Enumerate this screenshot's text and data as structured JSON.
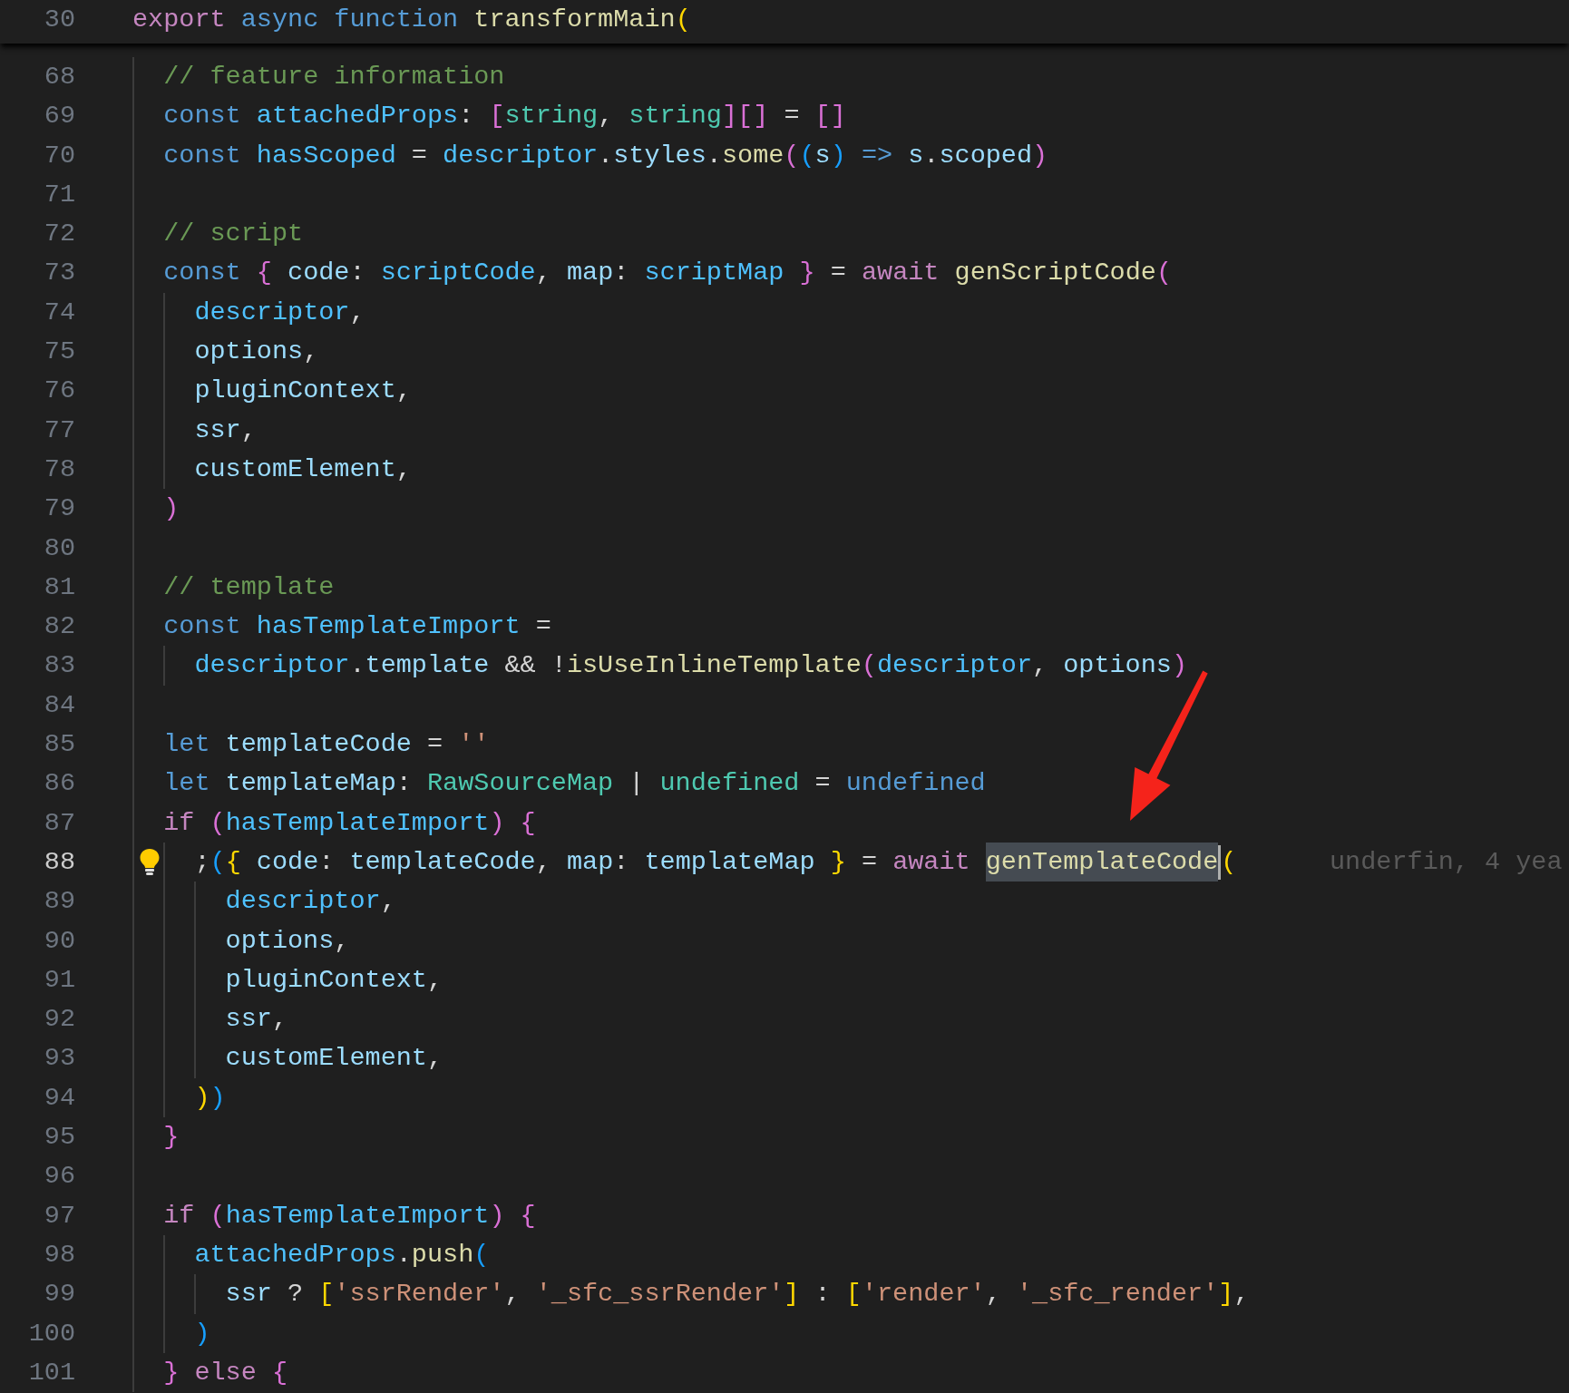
{
  "sticky_line": {
    "number": "30",
    "tokens": [
      {
        "kind": "control",
        "text": "export"
      },
      {
        "kind": "keyword",
        "text": " async"
      },
      {
        "kind": "keyword",
        "text": " function"
      },
      {
        "kind": "function",
        "text": " transformMain"
      },
      {
        "kind": "bracket1",
        "text": "("
      }
    ]
  },
  "lines": [
    {
      "number": "68",
      "current": false,
      "tokens": [
        {
          "kind": "comment",
          "text": "  // feature information"
        }
      ]
    },
    {
      "number": "69",
      "current": false,
      "tokens": [
        {
          "kind": "keyword",
          "text": "  const"
        },
        {
          "kind": "constant",
          "text": " attachedProps"
        },
        {
          "kind": "punct",
          "text": ": "
        },
        {
          "kind": "bracket2",
          "text": "["
        },
        {
          "kind": "type",
          "text": "string"
        },
        {
          "kind": "punct",
          "text": ", "
        },
        {
          "kind": "type",
          "text": "string"
        },
        {
          "kind": "bracket2",
          "text": "][]"
        },
        {
          "kind": "punct",
          "text": " = "
        },
        {
          "kind": "bracket2",
          "text": "[]"
        }
      ]
    },
    {
      "number": "70",
      "current": false,
      "tokens": [
        {
          "kind": "keyword",
          "text": "  const"
        },
        {
          "kind": "constant",
          "text": " hasScoped"
        },
        {
          "kind": "punct",
          "text": " = "
        },
        {
          "kind": "constant",
          "text": "descriptor"
        },
        {
          "kind": "punct",
          "text": "."
        },
        {
          "kind": "variable",
          "text": "styles"
        },
        {
          "kind": "punct",
          "text": "."
        },
        {
          "kind": "function",
          "text": "some"
        },
        {
          "kind": "bracket2",
          "text": "("
        },
        {
          "kind": "bracket3",
          "text": "("
        },
        {
          "kind": "variable",
          "text": "s"
        },
        {
          "kind": "bracket3",
          "text": ")"
        },
        {
          "kind": "keyword",
          "text": " =>"
        },
        {
          "kind": "variable",
          "text": " s"
        },
        {
          "kind": "punct",
          "text": "."
        },
        {
          "kind": "variable",
          "text": "scoped"
        },
        {
          "kind": "bracket2",
          "text": ")"
        }
      ]
    },
    {
      "number": "71",
      "current": false
    },
    {
      "number": "72",
      "current": false,
      "tokens": [
        {
          "kind": "comment",
          "text": "  // script"
        }
      ]
    },
    {
      "number": "73",
      "current": false,
      "tokens": [
        {
          "kind": "keyword",
          "text": "  const"
        },
        {
          "kind": "bracket2",
          "text": " {"
        },
        {
          "kind": "variable",
          "text": " code"
        },
        {
          "kind": "punct",
          "text": ": "
        },
        {
          "kind": "constant",
          "text": "scriptCode"
        },
        {
          "kind": "punct",
          "text": ", "
        },
        {
          "kind": "variable",
          "text": "map"
        },
        {
          "kind": "punct",
          "text": ": "
        },
        {
          "kind": "constant",
          "text": "scriptMap"
        },
        {
          "kind": "bracket2",
          "text": " }"
        },
        {
          "kind": "punct",
          "text": " = "
        },
        {
          "kind": "control",
          "text": "await"
        },
        {
          "kind": "function",
          "text": " genScriptCode"
        },
        {
          "kind": "bracket2",
          "text": "("
        }
      ]
    },
    {
      "number": "74",
      "current": false,
      "tokens": [
        {
          "kind": "constant",
          "text": "    descriptor"
        },
        {
          "kind": "punct",
          "text": ","
        }
      ]
    },
    {
      "number": "75",
      "current": false,
      "tokens": [
        {
          "kind": "variable",
          "text": "    options"
        },
        {
          "kind": "punct",
          "text": ","
        }
      ]
    },
    {
      "number": "76",
      "current": false,
      "tokens": [
        {
          "kind": "variable",
          "text": "    pluginContext"
        },
        {
          "kind": "punct",
          "text": ","
        }
      ]
    },
    {
      "number": "77",
      "current": false,
      "tokens": [
        {
          "kind": "variable",
          "text": "    ssr"
        },
        {
          "kind": "punct",
          "text": ","
        }
      ]
    },
    {
      "number": "78",
      "current": false,
      "tokens": [
        {
          "kind": "variable",
          "text": "    customElement"
        },
        {
          "kind": "punct",
          "text": ","
        }
      ]
    },
    {
      "number": "79",
      "current": false,
      "tokens": [
        {
          "kind": "bracket2",
          "text": "  )"
        }
      ]
    },
    {
      "number": "80",
      "current": false
    },
    {
      "number": "81",
      "current": false,
      "tokens": [
        {
          "kind": "comment",
          "text": "  // template"
        }
      ]
    },
    {
      "number": "82",
      "current": false,
      "tokens": [
        {
          "kind": "keyword",
          "text": "  const"
        },
        {
          "kind": "constant",
          "text": " hasTemplateImport"
        },
        {
          "kind": "punct",
          "text": " ="
        }
      ]
    },
    {
      "number": "83",
      "current": false,
      "tokens": [
        {
          "kind": "constant",
          "text": "    descriptor"
        },
        {
          "kind": "punct",
          "text": "."
        },
        {
          "kind": "variable",
          "text": "template"
        },
        {
          "kind": "punct",
          "text": " && !"
        },
        {
          "kind": "function",
          "text": "isUseInlineTemplate"
        },
        {
          "kind": "bracket2",
          "text": "("
        },
        {
          "kind": "constant",
          "text": "descriptor"
        },
        {
          "kind": "punct",
          "text": ", "
        },
        {
          "kind": "variable",
          "text": "options"
        },
        {
          "kind": "bracket2",
          "text": ")"
        }
      ]
    },
    {
      "number": "84",
      "current": false
    },
    {
      "number": "85",
      "current": false,
      "tokens": [
        {
          "kind": "keyword",
          "text": "  let"
        },
        {
          "kind": "variable",
          "text": " templateCode"
        },
        {
          "kind": "punct",
          "text": " = "
        },
        {
          "kind": "string",
          "text": "''"
        }
      ]
    },
    {
      "number": "86",
      "current": false,
      "tokens": [
        {
          "kind": "keyword",
          "text": "  let"
        },
        {
          "kind": "variable",
          "text": " templateMap"
        },
        {
          "kind": "punct",
          "text": ": "
        },
        {
          "kind": "type",
          "text": "RawSourceMap"
        },
        {
          "kind": "punct",
          "text": " | "
        },
        {
          "kind": "type",
          "text": "undefined"
        },
        {
          "kind": "punct",
          "text": " = "
        },
        {
          "kind": "keyword",
          "text": "undefined"
        }
      ]
    },
    {
      "number": "87",
      "current": false,
      "tokens": [
        {
          "kind": "control",
          "text": "  if"
        },
        {
          "kind": "bracket2",
          "text": " ("
        },
        {
          "kind": "constant",
          "text": "hasTemplateImport"
        },
        {
          "kind": "bracket2",
          "text": ")"
        },
        {
          "kind": "bracket2",
          "text": " {"
        }
      ]
    },
    {
      "number": "88",
      "current": true,
      "lightbulb": true,
      "blame": "underfin, 4 yea",
      "tokens": [
        {
          "kind": "punct",
          "text": "    ;"
        },
        {
          "kind": "bracket3",
          "text": "("
        },
        {
          "kind": "bracket1",
          "text": "{"
        },
        {
          "kind": "variable",
          "text": " code"
        },
        {
          "kind": "punct",
          "text": ": "
        },
        {
          "kind": "variable",
          "text": "templateCode"
        },
        {
          "kind": "punct",
          "text": ", "
        },
        {
          "kind": "variable",
          "text": "map"
        },
        {
          "kind": "punct",
          "text": ": "
        },
        {
          "kind": "variable",
          "text": "templateMap"
        },
        {
          "kind": "bracket1",
          "text": " }"
        },
        {
          "kind": "punct",
          "text": " = "
        },
        {
          "kind": "control",
          "text": "await "
        },
        {
          "kind": "function",
          "text": "genTemplateCode",
          "highlighted": true
        },
        {
          "kind": "bracket1",
          "text": "("
        }
      ]
    },
    {
      "number": "89",
      "current": false,
      "tokens": [
        {
          "kind": "constant",
          "text": "      descriptor"
        },
        {
          "kind": "punct",
          "text": ","
        }
      ]
    },
    {
      "number": "90",
      "current": false,
      "tokens": [
        {
          "kind": "variable",
          "text": "      options"
        },
        {
          "kind": "punct",
          "text": ","
        }
      ]
    },
    {
      "number": "91",
      "current": false,
      "tokens": [
        {
          "kind": "variable",
          "text": "      pluginContext"
        },
        {
          "kind": "punct",
          "text": ","
        }
      ]
    },
    {
      "number": "92",
      "current": false,
      "tokens": [
        {
          "kind": "variable",
          "text": "      ssr"
        },
        {
          "kind": "punct",
          "text": ","
        }
      ]
    },
    {
      "number": "93",
      "current": false,
      "tokens": [
        {
          "kind": "variable",
          "text": "      customElement"
        },
        {
          "kind": "punct",
          "text": ","
        }
      ]
    },
    {
      "number": "94",
      "current": false,
      "tokens": [
        {
          "kind": "bracket1",
          "text": "    )"
        },
        {
          "kind": "bracket3",
          "text": ")"
        }
      ]
    },
    {
      "number": "95",
      "current": false,
      "tokens": [
        {
          "kind": "bracket2",
          "text": "  }"
        }
      ]
    },
    {
      "number": "96",
      "current": false
    },
    {
      "number": "97",
      "current": false,
      "tokens": [
        {
          "kind": "control",
          "text": "  if"
        },
        {
          "kind": "bracket2",
          "text": " ("
        },
        {
          "kind": "constant",
          "text": "hasTemplateImport"
        },
        {
          "kind": "bracket2",
          "text": ")"
        },
        {
          "kind": "bracket2",
          "text": " {"
        }
      ]
    },
    {
      "number": "98",
      "current": false,
      "tokens": [
        {
          "kind": "constant",
          "text": "    attachedProps"
        },
        {
          "kind": "punct",
          "text": "."
        },
        {
          "kind": "function",
          "text": "push"
        },
        {
          "kind": "bracket3",
          "text": "("
        }
      ]
    },
    {
      "number": "99",
      "current": false,
      "tokens": [
        {
          "kind": "variable",
          "text": "      ssr"
        },
        {
          "kind": "punct",
          "text": " ? "
        },
        {
          "kind": "bracket1",
          "text": "["
        },
        {
          "kind": "string",
          "text": "'ssrRender'"
        },
        {
          "kind": "punct",
          "text": ", "
        },
        {
          "kind": "string",
          "text": "'_sfc_ssrRender'"
        },
        {
          "kind": "bracket1",
          "text": "]"
        },
        {
          "kind": "punct",
          "text": " : "
        },
        {
          "kind": "bracket1",
          "text": "["
        },
        {
          "kind": "string",
          "text": "'render'"
        },
        {
          "kind": "punct",
          "text": ", "
        },
        {
          "kind": "string",
          "text": "'_sfc_render'"
        },
        {
          "kind": "bracket1",
          "text": "]"
        },
        {
          "kind": "punct",
          "text": ","
        }
      ]
    },
    {
      "number": "100",
      "current": false,
      "tokens": [
        {
          "kind": "bracket3",
          "text": "    )"
        }
      ]
    },
    {
      "number": "101",
      "current": false,
      "tokens": [
        {
          "kind": "bracket2",
          "text": "  }"
        },
        {
          "kind": "control",
          "text": " else"
        },
        {
          "kind": "bracket2",
          "text": " {"
        }
      ]
    }
  ]
}
